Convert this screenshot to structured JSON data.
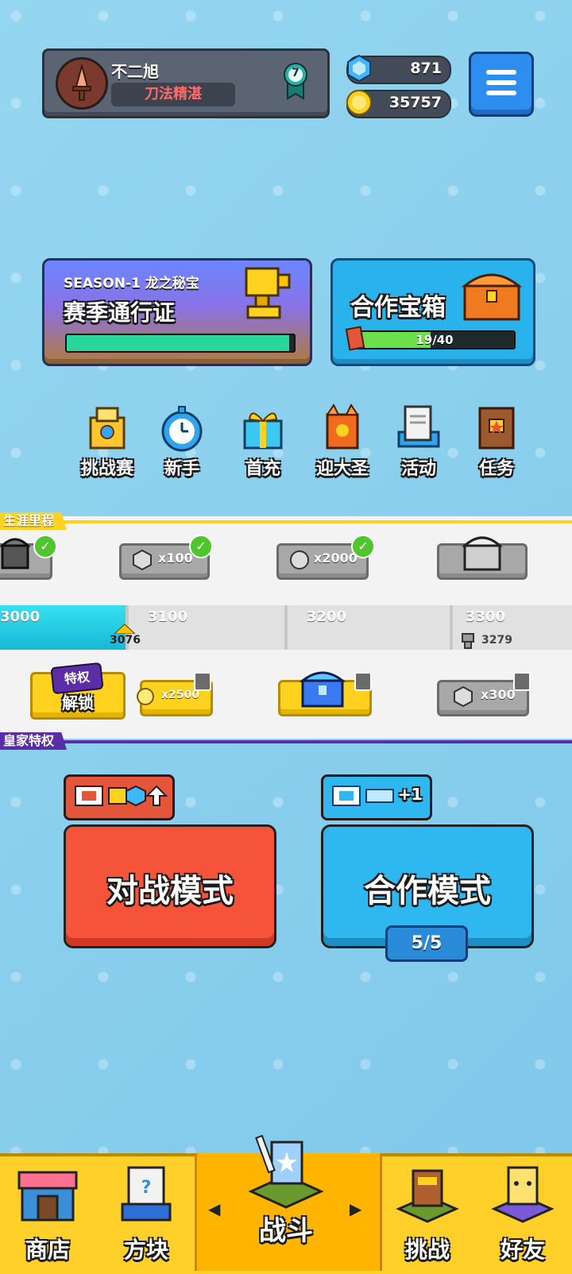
{
  "profile": {
    "name": "不二旭",
    "title": "刀法精湛",
    "rank": "7"
  },
  "currency": {
    "gems": "871",
    "coins": "35757"
  },
  "season": {
    "label": "SEASON-1 龙之秘宝",
    "title": "赛季通行证",
    "progress": 0.98
  },
  "coop_chest": {
    "title": "合作宝箱",
    "progress_text": "19/40",
    "progress": 0.475
  },
  "features": [
    {
      "label": "挑战赛",
      "icon": "tournament-icon"
    },
    {
      "label": "新手",
      "icon": "stopwatch-icon"
    },
    {
      "label": "首充",
      "icon": "gift-icon"
    },
    {
      "label": "迎大圣",
      "icon": "monkey-king-icon"
    },
    {
      "label": "活动",
      "icon": "event-icon"
    },
    {
      "label": "任务",
      "icon": "quest-book-icon"
    }
  ],
  "career": {
    "label": "生涯里程",
    "rewards_top": [
      "",
      "x100",
      "x2000",
      ""
    ],
    "ticks": [
      "3000",
      "3100",
      "3200",
      "3300"
    ],
    "current": "3076",
    "trophies": "3279",
    "progress": 0.22,
    "rewards_bottom": [
      "解锁",
      "x2500",
      "",
      "x300"
    ],
    "premium_badge": "特权"
  },
  "royal": {
    "label": "皇家特权"
  },
  "modes": {
    "battle": {
      "label": "对战模式"
    },
    "coop": {
      "label": "合作模式",
      "counter": "5/5",
      "bonus": "+1"
    }
  },
  "nav": [
    {
      "label": "商店",
      "icon": "shop-icon"
    },
    {
      "label": "方块",
      "icon": "block-icon"
    },
    {
      "label": "战斗",
      "icon": "battle-icon"
    },
    {
      "label": "挑战",
      "icon": "challenge-icon"
    },
    {
      "label": "好友",
      "icon": "friends-icon"
    }
  ],
  "colors": {
    "battle": "#f5543a",
    "coop": "#2fb7ef",
    "nav": "#ffcf2a"
  }
}
